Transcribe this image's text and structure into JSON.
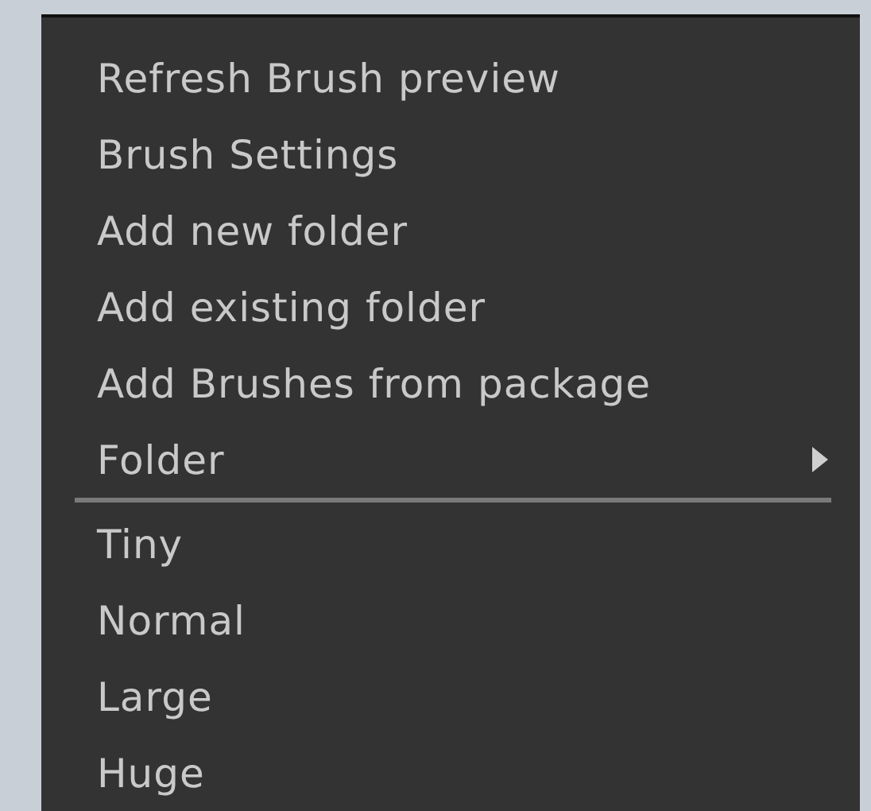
{
  "context_menu": {
    "items": [
      {
        "label": "Refresh Brush preview",
        "kind": "action"
      },
      {
        "label": "Brush Settings",
        "kind": "action"
      },
      {
        "label": "Add new folder",
        "kind": "action"
      },
      {
        "label": "Add existing folder",
        "kind": "action"
      },
      {
        "label": "Add Brushes from package",
        "kind": "action"
      },
      {
        "label": "Folder",
        "kind": "submenu"
      }
    ],
    "size_items": [
      {
        "label": "Tiny",
        "kind": "action"
      },
      {
        "label": "Normal",
        "kind": "action"
      },
      {
        "label": "Large",
        "kind": "action"
      },
      {
        "label": "Huge",
        "kind": "action"
      }
    ]
  }
}
